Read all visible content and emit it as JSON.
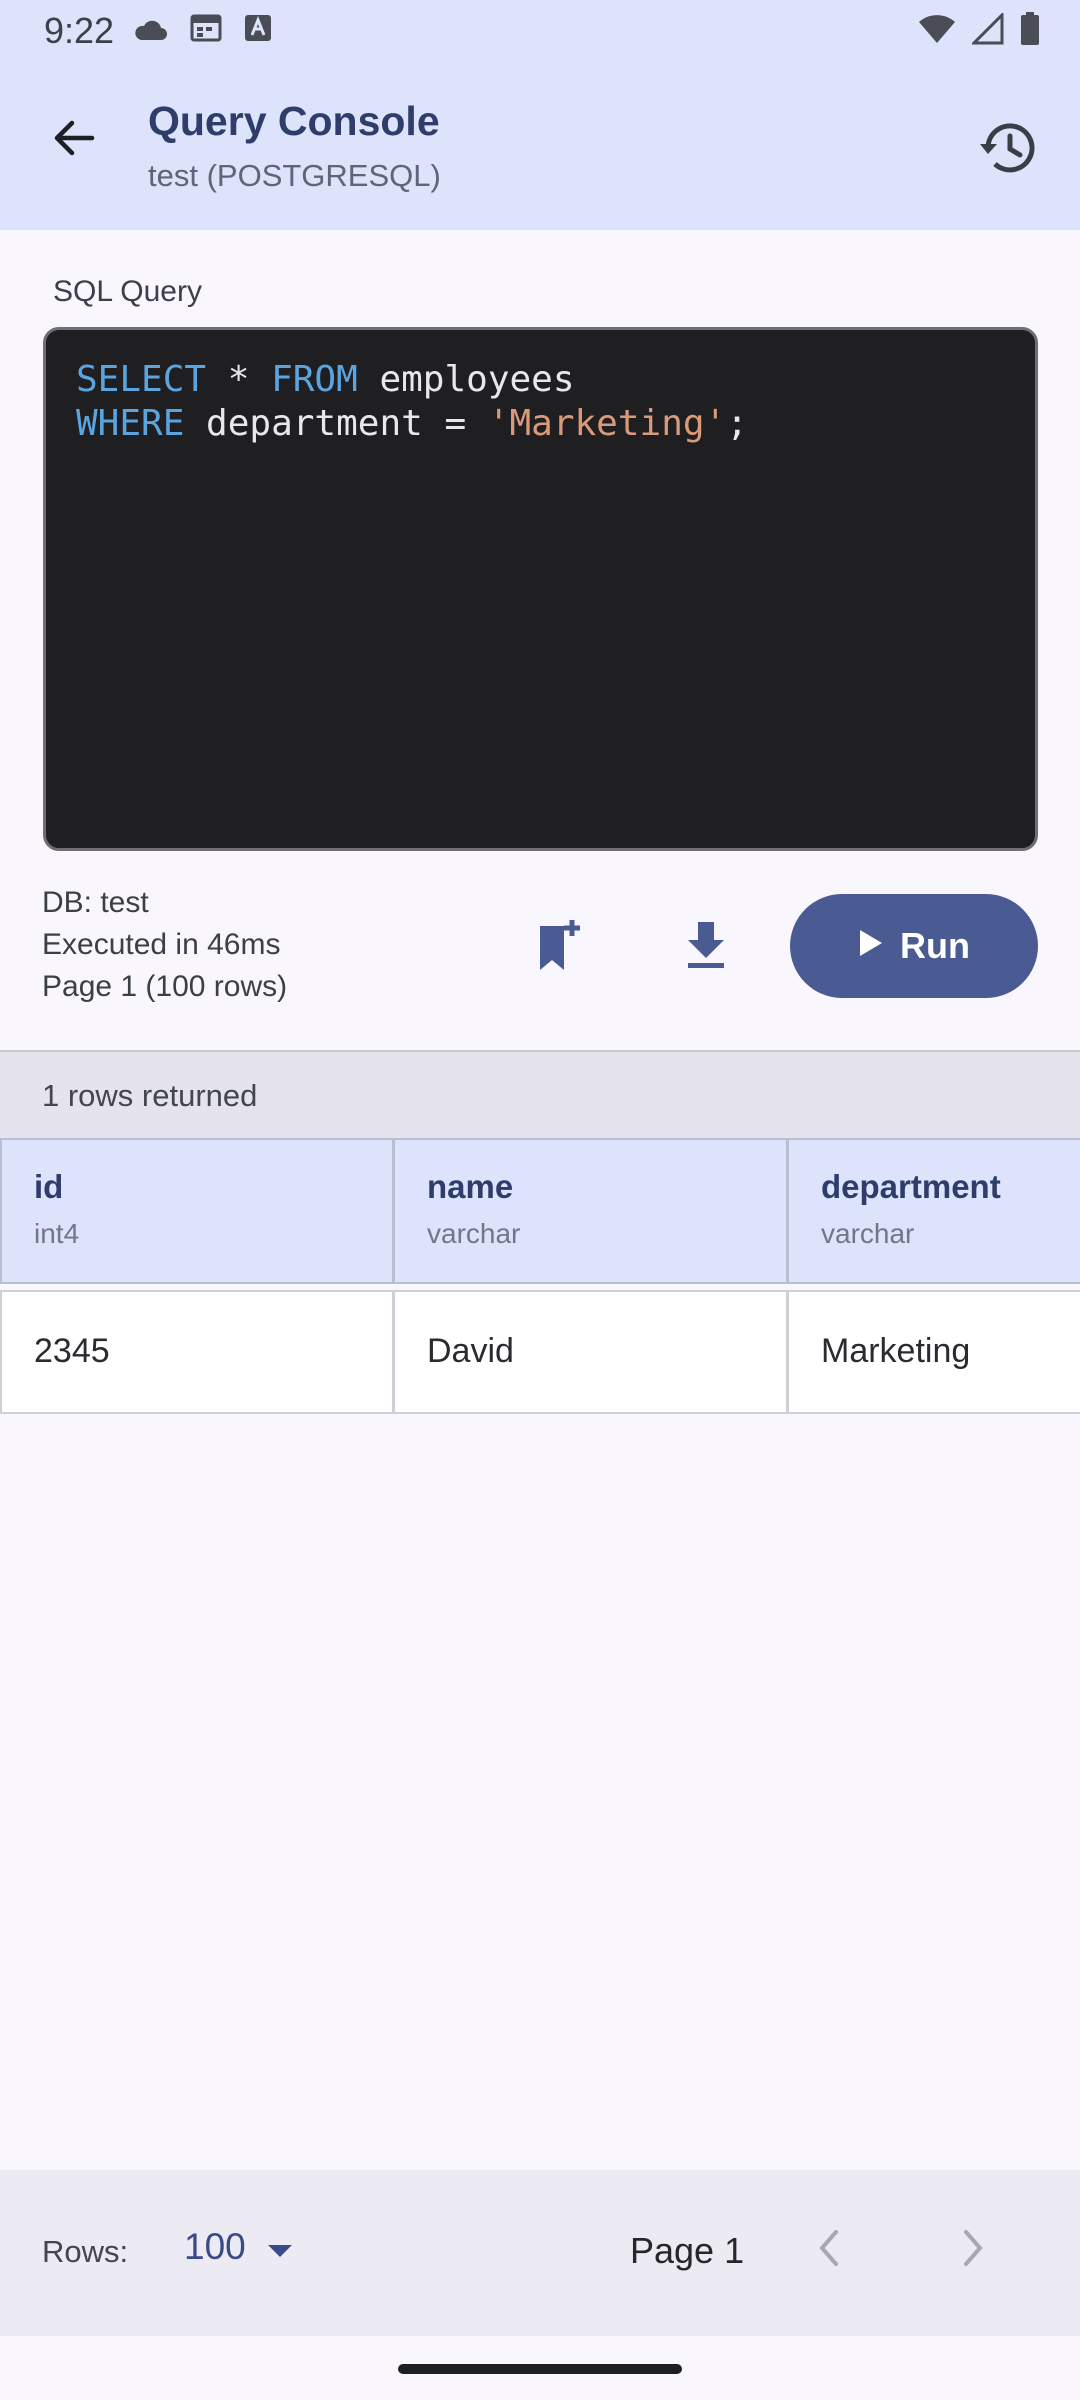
{
  "status_bar": {
    "time": "9:22",
    "left_icons": [
      "cloud-icon",
      "calendar-icon",
      "font-icon"
    ],
    "right_icons": [
      "wifi-icon",
      "signal-icon",
      "battery-icon"
    ]
  },
  "app_bar": {
    "title": "Query Console",
    "subtitle": "test (POSTGRESQL)",
    "back_icon": "arrow-back-icon",
    "history_icon": "history-icon"
  },
  "editor": {
    "label": "SQL Query",
    "line1": {
      "kw1": "SELECT",
      "mid1": " * ",
      "kw2": "FROM",
      "rest": " employees"
    },
    "line2": {
      "kw": "WHERE",
      "mid": " department = ",
      "str": "'Marketing'",
      "end": ";"
    }
  },
  "meta": {
    "db": "DB: test",
    "executed": "Executed in 46ms",
    "page": "Page 1 (100 rows)"
  },
  "actions": {
    "bookmark_icon": "bookmark-add-icon",
    "download_icon": "download-icon",
    "run_label": "Run"
  },
  "results": {
    "summary": "1 rows returned",
    "columns": [
      {
        "name": "id",
        "type": "int4"
      },
      {
        "name": "name",
        "type": "varchar"
      },
      {
        "name": "department",
        "type": "varchar"
      }
    ],
    "rows": [
      [
        "2345",
        "David",
        "Marketing"
      ]
    ]
  },
  "footer": {
    "rows_label": "Rows:",
    "rows_value": "100",
    "page_label": "Page 1"
  },
  "colors": {
    "accent": "#495b92",
    "app_bar_bg": "#dce3fb",
    "editor_bg": "#1f1e21",
    "keyword": "#5aa4e0",
    "string": "#d99a7a"
  }
}
